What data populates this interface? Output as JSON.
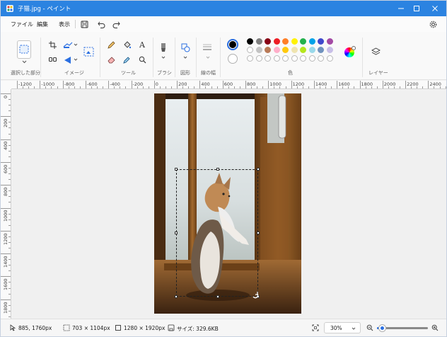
{
  "window": {
    "title": "子猫.jpg - ペイント"
  },
  "menu": {
    "file": "ファイル",
    "edit": "編集",
    "view": "表示"
  },
  "ribbon": {
    "groups": {
      "selection": "選択した部分",
      "image": "イメージ",
      "tools": "ツール",
      "brush": "ブラシ",
      "shapes": "図形",
      "line_width": "線の幅",
      "colors": "色",
      "layers": "レイヤー"
    },
    "text_tool_glyph": "A"
  },
  "colors": {
    "primary": "#000000",
    "secondary": "#ffffff",
    "accent_titlebar": "#2b83e1",
    "palette_row1": [
      "#000000",
      "#7f7f7f",
      "#880015",
      "#ed1c24",
      "#ff7f27",
      "#fff200",
      "#22b14c",
      "#00a2e8",
      "#3f48cc",
      "#a349a4"
    ],
    "palette_row2": [
      "#ffffff",
      "#c3c3c3",
      "#b97a57",
      "#ffaec9",
      "#ffc90e",
      "#efe4b0",
      "#b5e61d",
      "#99d9ea",
      "#7092be",
      "#c8bfe7"
    ],
    "palette_row3_empty": 10
  },
  "ruler": {
    "h_labels": [
      "-1200",
      "-1000",
      "-800",
      "-600",
      "-400",
      "-200",
      "0",
      "200",
      "400",
      "600",
      "800",
      "1000",
      "1200",
      "1400",
      "1600",
      "1800",
      "2000",
      "2200",
      "2400"
    ],
    "v_labels": [
      "0",
      "200",
      "400",
      "600",
      "800",
      "1000",
      "1200",
      "1400",
      "1600",
      "1800"
    ]
  },
  "status": {
    "cursor_pos": "885, 1760px",
    "selection_size": "703 × 1104px",
    "image_size": "1280 × 1920px",
    "file_size": "サイズ: 329.6KB",
    "zoom": "30%"
  },
  "icons": {
    "app": "paint-app-icon",
    "minimize": "minimize-icon",
    "maximize": "maximize-icon",
    "close": "close-icon",
    "save": "save-icon",
    "undo": "undo-icon",
    "redo": "redo-icon",
    "settings": "gear-icon"
  }
}
